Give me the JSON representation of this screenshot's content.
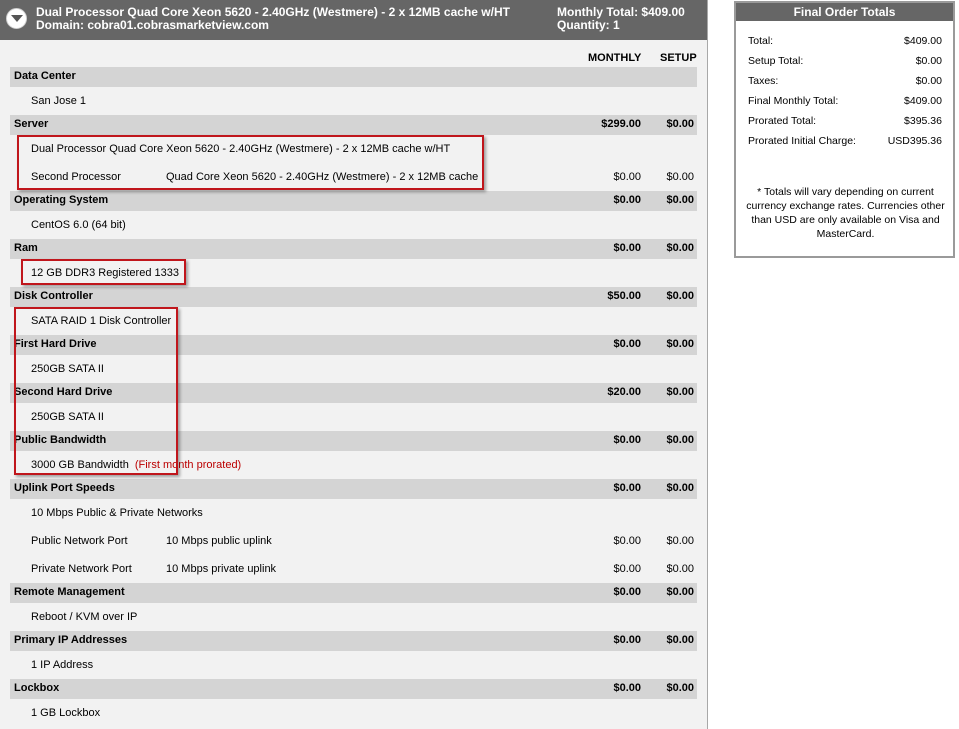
{
  "header": {
    "title": "Dual Processor Quad Core Xeon 5620 - 2.40GHz (Westmere) - 2 x 12MB cache w/HT",
    "domain": "Domain: cobra01.cobrasmarketview.com",
    "monthly_total": "Monthly Total: $409.00",
    "quantity": "Quantity: 1"
  },
  "columns": {
    "monthly": "MONTHLY",
    "setup": "SETUP"
  },
  "sections": [
    {
      "title": "Data Center",
      "monthly": "",
      "setup": "",
      "items": [
        {
          "name": "San Jose 1",
          "detail": "",
          "monthly": "",
          "setup": ""
        }
      ]
    },
    {
      "title": "Server",
      "monthly": "$299.00",
      "setup": "$0.00",
      "items": [
        {
          "name": "Dual Processor Quad Core Xeon 5620 - 2.40GHz (Westmere) - 2 x 12MB cache w/HT",
          "detail": "",
          "monthly": "",
          "setup": ""
        },
        {
          "name": "Second Processor",
          "detail": "Quad Core Xeon 5620 - 2.40GHz (Westmere) - 2 x 12MB cache",
          "monthly": "$0.00",
          "setup": "$0.00"
        }
      ]
    },
    {
      "title": "Operating System",
      "monthly": "$0.00",
      "setup": "$0.00",
      "items": [
        {
          "name": "CentOS 6.0 (64 bit)",
          "detail": "",
          "monthly": "",
          "setup": ""
        }
      ]
    },
    {
      "title": "Ram",
      "monthly": "$0.00",
      "setup": "$0.00",
      "items": [
        {
          "name": "12 GB DDR3 Registered 1333",
          "detail": "",
          "monthly": "",
          "setup": ""
        }
      ]
    },
    {
      "title": "Disk Controller",
      "monthly": "$50.00",
      "setup": "$0.00",
      "items": [
        {
          "name": "SATA RAID 1 Disk Controller",
          "detail": "",
          "monthly": "",
          "setup": ""
        }
      ]
    },
    {
      "title": "First Hard Drive",
      "monthly": "$0.00",
      "setup": "$0.00",
      "items": [
        {
          "name": "250GB SATA II",
          "detail": "",
          "monthly": "",
          "setup": ""
        }
      ]
    },
    {
      "title": "Second Hard Drive",
      "monthly": "$20.00",
      "setup": "$0.00",
      "items": [
        {
          "name": "250GB SATA II",
          "detail": "",
          "monthly": "",
          "setup": ""
        }
      ]
    },
    {
      "title": "Public Bandwidth",
      "monthly": "$0.00",
      "setup": "$0.00",
      "items": [
        {
          "name": "3000 GB Bandwidth",
          "note": "(First month prorated)",
          "detail": "",
          "monthly": "",
          "setup": ""
        }
      ]
    },
    {
      "title": "Uplink Port Speeds",
      "monthly": "$0.00",
      "setup": "$0.00",
      "items": [
        {
          "name": "10 Mbps Public & Private Networks",
          "detail": "",
          "monthly": "",
          "setup": ""
        },
        {
          "name": "Public Network Port",
          "detail": "10 Mbps public uplink",
          "monthly": "$0.00",
          "setup": "$0.00"
        },
        {
          "name": "Private Network Port",
          "detail": "10 Mbps private uplink",
          "monthly": "$0.00",
          "setup": "$0.00"
        }
      ]
    },
    {
      "title": "Remote Management",
      "monthly": "$0.00",
      "setup": "$0.00",
      "items": [
        {
          "name": "Reboot / KVM over IP",
          "detail": "",
          "monthly": "",
          "setup": ""
        }
      ]
    },
    {
      "title": "Primary IP Addresses",
      "monthly": "$0.00",
      "setup": "$0.00",
      "items": [
        {
          "name": "1 IP Address",
          "detail": "",
          "monthly": "",
          "setup": ""
        }
      ]
    },
    {
      "title": "Lockbox",
      "monthly": "$0.00",
      "setup": "$0.00",
      "items": [
        {
          "name": "1 GB Lockbox",
          "detail": "",
          "monthly": "",
          "setup": ""
        }
      ]
    }
  ],
  "totals": {
    "title": "Final Order Totals",
    "rows": [
      {
        "label": "Total:",
        "value": "$409.00"
      },
      {
        "label": "Setup Total:",
        "value": "$0.00"
      },
      {
        "label": "Taxes:",
        "value": "$0.00"
      },
      {
        "label": "Final Monthly Total:",
        "value": "$409.00"
      },
      {
        "label": "Prorated Total:",
        "value": "$395.36"
      },
      {
        "label": "Prorated Initial Charge:",
        "value": "USD395.36"
      }
    ],
    "disclaimer": "* Totals will vary depending on current currency exchange rates. Currencies other than USD are only available on Visa and MasterCard."
  },
  "colors": {
    "header_bg": "#666666",
    "section_bg": "#d4d4d4",
    "panel_bg": "#f2f2f2",
    "highlight": "#c0161c",
    "note": "#bb0000"
  }
}
